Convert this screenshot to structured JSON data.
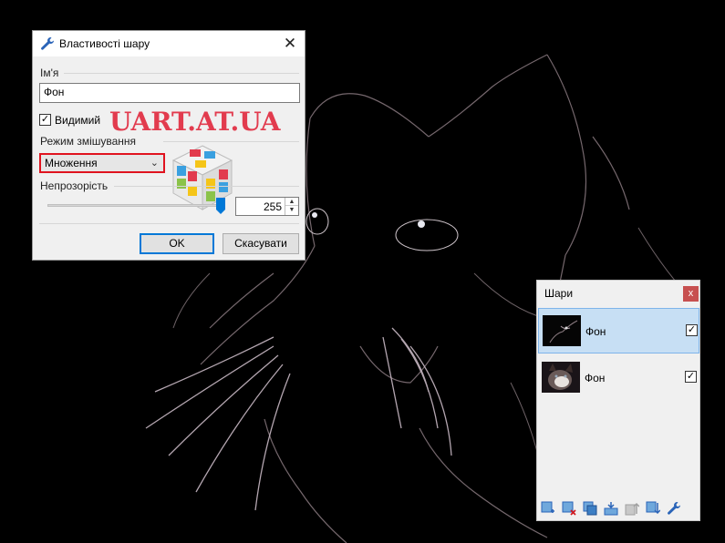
{
  "layer_properties_dialog": {
    "title": "Властивості шару",
    "title_icon": "wrench-icon",
    "close_icon": "close-icon",
    "close_glyph": "✕",
    "name_label": "Ім'я",
    "name_value": "Фон",
    "visible_label": "Видимий",
    "visible_checked": true,
    "check_glyph": "✓",
    "blend_mode_label": "Режим змішування",
    "blend_mode_value": "Множення",
    "blend_mode_chevron": "⌄",
    "opacity_label": "Непрозорість",
    "opacity_value": "255",
    "spin_up": "▲",
    "spin_down": "▼",
    "ok_label": "OK",
    "cancel_label": "Скасувати",
    "highlight_color": "#e0131f"
  },
  "watermark": {
    "text": "UART.AT.UA",
    "color": "#e23b4e"
  },
  "layers_panel": {
    "title": "Шари",
    "close_glyph": "x",
    "layers": [
      {
        "name": "Фон",
        "visible": true,
        "selected": true
      },
      {
        "name": "Фон",
        "visible": true,
        "selected": false
      }
    ],
    "check_glyph": "✓",
    "toolbar_icons": [
      "add-layer-icon",
      "delete-layer-icon",
      "duplicate-layer-icon",
      "merge-layer-down-icon",
      "move-layer-up-icon",
      "move-layer-down-icon",
      "layer-properties-icon"
    ],
    "selection_color": "#c7dff4"
  }
}
